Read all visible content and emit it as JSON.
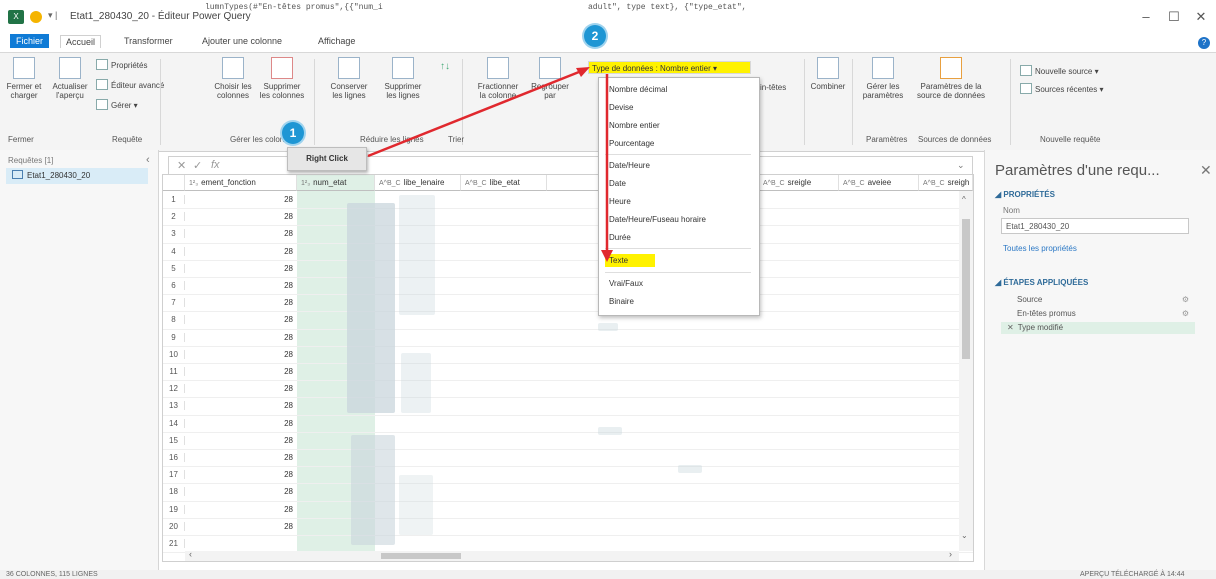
{
  "window": {
    "title": "Etat1_280430_20 - Éditeur Power Query",
    "app_icon_text": "X",
    "minimize": "–",
    "maximize": "☐",
    "close": "✕"
  },
  "tabs": [
    "Fichier",
    "Accueil",
    "Transformer",
    "Ajouter une colonne",
    "Affichage"
  ],
  "ribbon": {
    "close_load": "Fermer et charger",
    "refresh": "Actualiser l'aperçu",
    "properties": "Propriétés",
    "advanced_editor": "Éditeur avancé",
    "manage": "Gérer",
    "choose_columns": "Choisir les colonnes",
    "remove_columns": "Supprimer les colonnes",
    "keep_rows": "Conserver les lignes",
    "remove_rows": "Supprimer les lignes",
    "split_column": "Fractionner la colonne",
    "group_by": "Regrouper par",
    "use_headers": "in-têtes",
    "combine": "Combiner",
    "manage_params": "Gérer les paramètres",
    "datasource_settings": "Paramètres de la source de données",
    "new_source": "Nouvelle source",
    "recent_sources": "Sources récentes",
    "groups": {
      "close": "Fermer",
      "query": "Requête",
      "manage_cols": "Gérer les colonnes",
      "reduce_rows": "Réduire les lignes",
      "sort": "Trier",
      "parameters": "Paramètres",
      "data_sources": "Sources de données",
      "new_query": "Nouvelle requête"
    }
  },
  "datatype": {
    "button_label": "Type de données : Nombre entier",
    "options": [
      "Nombre décimal",
      "Devise",
      "Nombre entier",
      "Pourcentage",
      "Date/Heure",
      "Date",
      "Heure",
      "Date/Heure/Fuseau horaire",
      "Durée",
      "Texte",
      "Vrai/Faux",
      "Binaire"
    ],
    "highlighted": "Texte"
  },
  "left_panel": {
    "header": "Requêtes [1]",
    "collapse": "‹",
    "query_name": "Etat1_280430_20"
  },
  "formula": {
    "cancel": "✕",
    "confirm": "✓",
    "fx": "fx",
    "text_left": "lumnTypes(#\"En-têtes promus\",{{\"num_i",
    "text_right": "adult\", type text}, {\"type_etat\","
  },
  "columns": [
    "ement_fonction",
    "num_etat",
    "libe_lenaire",
    "libe_etat",
    "sreigle",
    "aveiee",
    "sreigh"
  ],
  "rows": [
    {
      "n": "1",
      "v": "28"
    },
    {
      "n": "2",
      "v": "28"
    },
    {
      "n": "3",
      "v": "28"
    },
    {
      "n": "4",
      "v": "28"
    },
    {
      "n": "5",
      "v": "28"
    },
    {
      "n": "6",
      "v": "28"
    },
    {
      "n": "7",
      "v": "28"
    },
    {
      "n": "8",
      "v": "28"
    },
    {
      "n": "9",
      "v": "28"
    },
    {
      "n": "10",
      "v": "28"
    },
    {
      "n": "11",
      "v": "28"
    },
    {
      "n": "12",
      "v": "28"
    },
    {
      "n": "13",
      "v": "28"
    },
    {
      "n": "14",
      "v": "28"
    },
    {
      "n": "15",
      "v": "28"
    },
    {
      "n": "16",
      "v": "28"
    },
    {
      "n": "17",
      "v": "28"
    },
    {
      "n": "18",
      "v": "28"
    },
    {
      "n": "19",
      "v": "28"
    },
    {
      "n": "20",
      "v": "28"
    },
    {
      "n": "21",
      "v": ""
    }
  ],
  "right_panel": {
    "title": "Paramètres d'une requ...",
    "close": "✕",
    "properties_heading": "PROPRIÉTÉS",
    "name_label": "Nom",
    "name_value": "Etat1_280430_20",
    "all_properties": "Toutes les propriétés",
    "steps_heading": "ÉTAPES APPLIQUÉES",
    "steps": [
      "Source",
      "En-têtes promus",
      "Type modifié"
    ]
  },
  "status": {
    "left": "36 COLONNES, 115 LIGNES",
    "right": "APERÇU TÉLÉCHARGÉ À 14:44"
  },
  "annotations": {
    "badge1": "1",
    "badge2": "2",
    "right_click": "Right Click",
    "arrow_color": "#e0282e",
    "highlight_color": "#fff200"
  }
}
